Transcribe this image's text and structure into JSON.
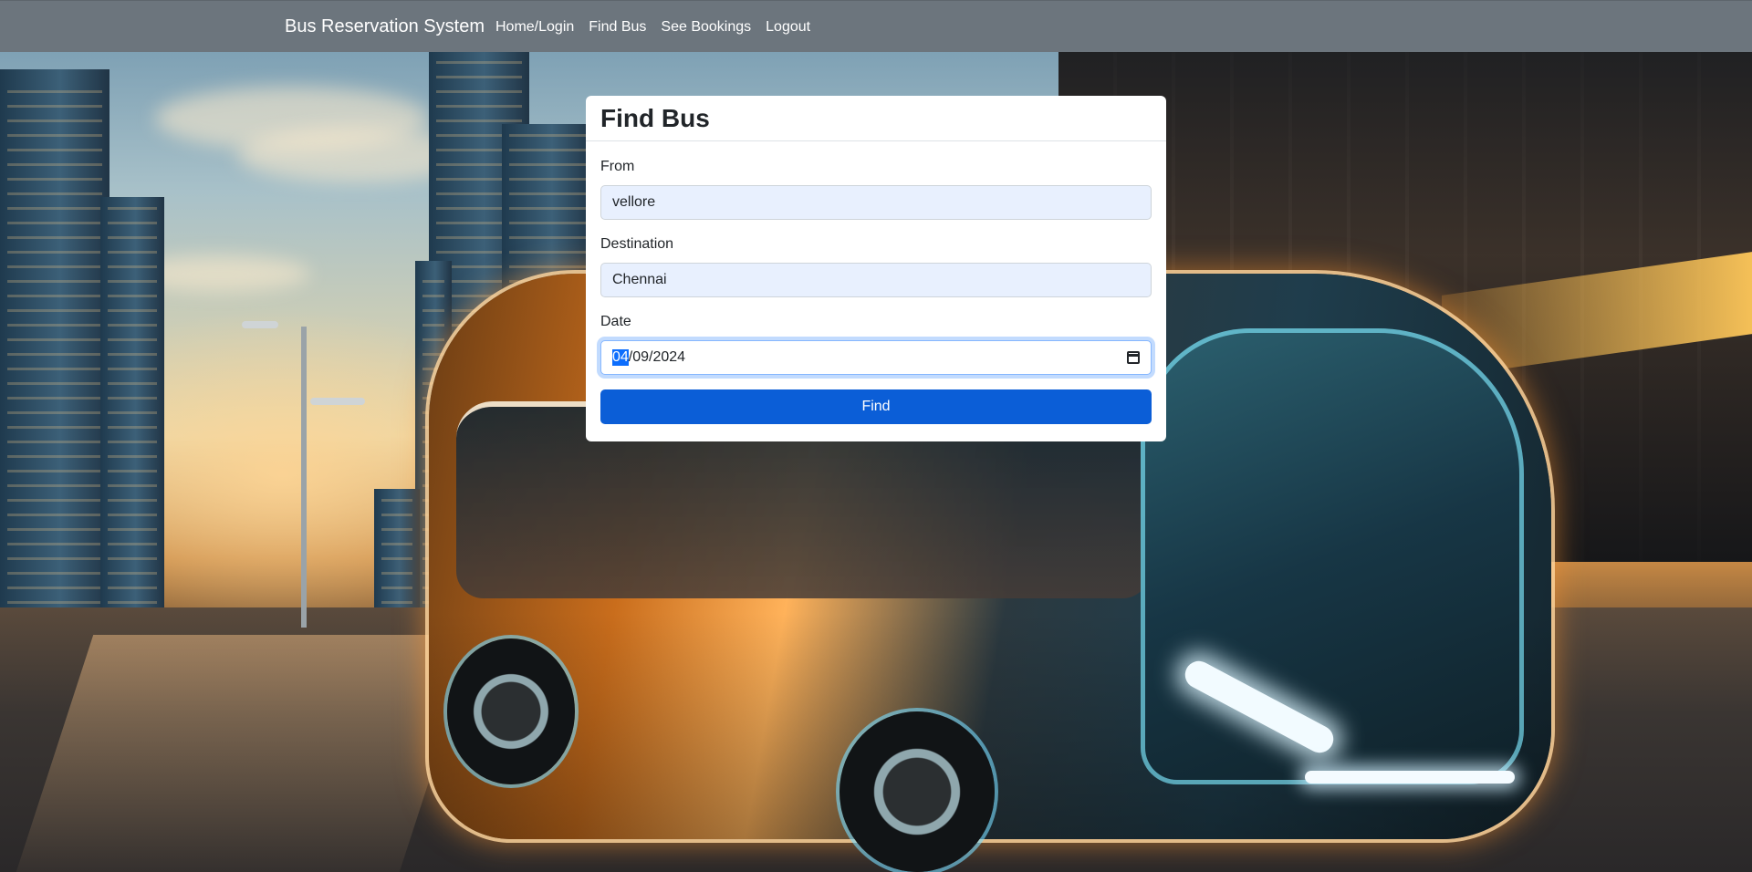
{
  "navbar": {
    "brand": "Bus Reservation System",
    "links": [
      "Home/Login",
      "Find Bus",
      "See Bookings",
      "Logout"
    ]
  },
  "form": {
    "title": "Find Bus",
    "from_label": "From",
    "from_value": "vellore",
    "destination_label": "Destination",
    "destination_value": "Chennai",
    "date_label": "Date",
    "date_selected_part": "04",
    "date_rest": "/09/2024",
    "submit_label": "Find"
  },
  "colors": {
    "navbar_bg": "#6c757d",
    "primary": "#0b5ed7",
    "autofill_bg": "#e8f0fe"
  },
  "icons": {
    "date_picker": "calendar-icon"
  }
}
